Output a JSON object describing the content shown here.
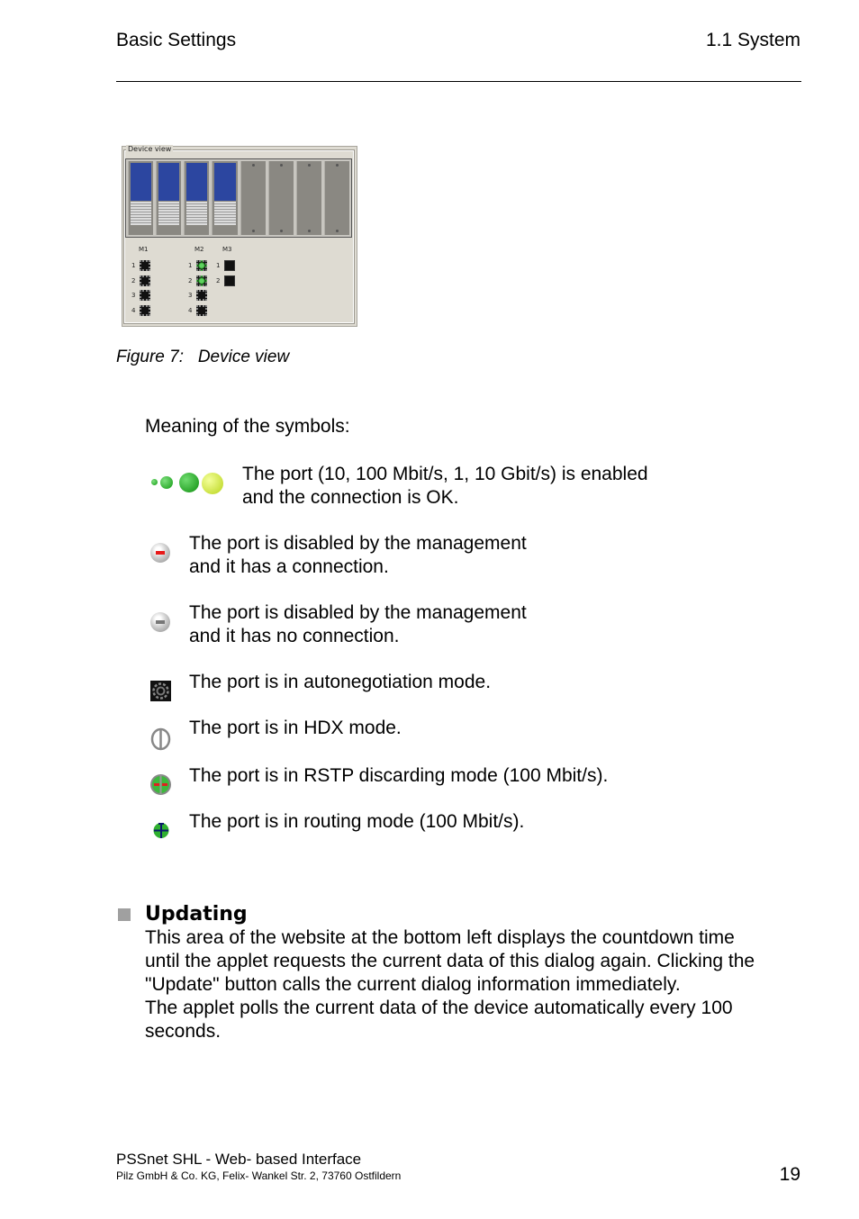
{
  "header": {
    "left": "Basic Settings",
    "right": "1.1 System"
  },
  "figure": {
    "panel_title": "Device view",
    "modules": [
      {
        "name": "M1",
        "ports": [
          {
            "num": "1",
            "icon": "autoneg-port-icon"
          },
          {
            "num": "2",
            "icon": "autoneg-port-icon"
          },
          {
            "num": "3",
            "icon": "autoneg-port-icon"
          },
          {
            "num": "4",
            "icon": "autoneg-port-icon"
          }
        ]
      },
      {
        "name": "M2",
        "ports": [
          {
            "num": "1",
            "icon": "port-ok-green-icon"
          },
          {
            "num": "2",
            "icon": "port-ok-green-icon"
          },
          {
            "num": "3",
            "icon": "autoneg-port-icon"
          },
          {
            "num": "4",
            "icon": "autoneg-port-icon"
          }
        ]
      },
      {
        "name": "M3",
        "ports": [
          {
            "num": "1",
            "icon": "port-empty-black-icon"
          },
          {
            "num": "2",
            "icon": "port-empty-black-icon"
          }
        ]
      }
    ],
    "caption_label": "Figure 7:",
    "caption_text": "Device view"
  },
  "symbols": {
    "intro": "Meaning of the symbols:",
    "items": [
      {
        "icon": "port-speed-balls-icon",
        "line1": "The port (10, 100 Mbit/s, 1, 10 Gbit/s) is enabled",
        "line2": "and the connection is OK."
      },
      {
        "icon": "disabled-connected-icon",
        "line1": "The port is disabled by the management",
        "line2": "and it has a connection."
      },
      {
        "icon": "disabled-no-connection-icon",
        "line1": "The port is disabled by the management",
        "line2": "and it has no connection."
      },
      {
        "icon": "autonegotiation-icon",
        "line1": "The port is in autonegotiation mode.",
        "line2": ""
      },
      {
        "icon": "hdx-icon",
        "line1": "The port is in HDX mode.",
        "line2": ""
      },
      {
        "icon": "rstp-discarding-icon",
        "line1": "The port is in RSTP discarding mode (100 Mbit/s).",
        "line2": ""
      },
      {
        "icon": "routing-icon",
        "line1": "The port is in routing mode (100 Mbit/s).",
        "line2": ""
      }
    ]
  },
  "updating": {
    "title": "Updating",
    "lines": [
      "This area of the website at the bottom left displays the countdown time",
      "until the applet requests the current data of this dialog again. Clicking the",
      "\"Update\" button calls the current dialog information immediately.",
      "The applet polls the current data of the device automatically every 100",
      "seconds."
    ]
  },
  "footer": {
    "title": "PSSnet SHL - Web- based Interface",
    "address": "Pilz GmbH & Co. KG, Felix- Wankel Str. 2, 73760 Ostfildern",
    "page_number": "19"
  }
}
